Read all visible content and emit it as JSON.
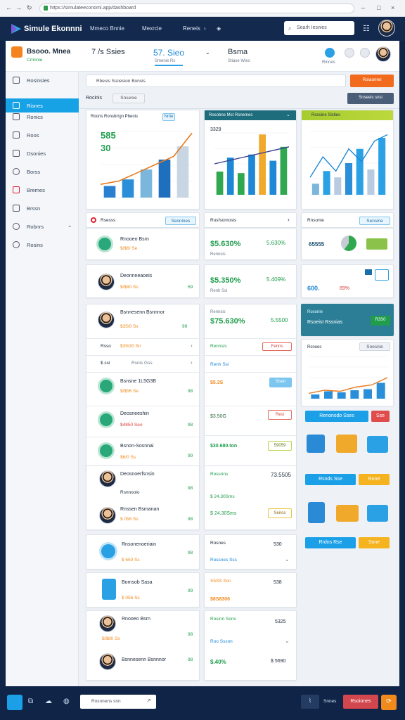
{
  "browser": {
    "url": "https://simulateeconomi.app/dashboard"
  },
  "app": {
    "brand": "Simule Ekonnni",
    "menu": [
      "Mmeco Bnnie",
      "Mexrcie",
      "Reneis"
    ],
    "search_placeholder": "Searh Iesnies"
  },
  "header": {
    "badge_title": "Bsooo. Mnea",
    "badge_sub": "Cmnnie",
    "stat1_main": "7 /s Ssies",
    "stat2_main": "57. Sieo",
    "stat2_sub": "Smenie Rs",
    "stat3_main": "Bsma",
    "stat3_sub": "Stiase Wies",
    "right_badge": "Rlnnes"
  },
  "sidebar": {
    "items": [
      {
        "label": "Rosinsies",
        "icon": "dashboard-icon"
      },
      {
        "label": "Risnes",
        "icon": "chart-icon"
      },
      {
        "label": "Ronics",
        "icon": "document-icon"
      },
      {
        "label": "Roos",
        "icon": "folder-icon"
      },
      {
        "label": "Dsonies",
        "icon": "tag-icon"
      },
      {
        "label": "Borss",
        "icon": "search-icon"
      },
      {
        "label": "Bremes",
        "icon": "mail-icon"
      },
      {
        "label": "Brssn",
        "icon": "calendar-icon"
      },
      {
        "label": "Robnrs",
        "icon": "settings-icon"
      },
      {
        "label": "Rosins",
        "icon": "help-icon"
      }
    ]
  },
  "toolbar": {
    "filter_text": "Rbesis   Ssnesion Bonsis",
    "primary_button": "Rsiaomei",
    "secondary_button": "Snseeis snsi",
    "tab_label": "Rocinis",
    "tab_pill": "Snsenie"
  },
  "charts": {
    "c1_title": "Rooris Ronsbrrgn Pbenis",
    "c1_badge": "Nnte",
    "c1_big1": "585",
    "c1_big2": "30",
    "c2_title": "Rosobne Mst Rsnemes",
    "c2_value": "3329",
    "c3_title": "Rossine Sisties"
  },
  "chart_data": [
    {
      "type": "bar",
      "title": "Rooris Ronsbrrgn Pbenis",
      "values": [
        14,
        22,
        34,
        46,
        62
      ],
      "line": [
        16,
        20,
        30,
        40,
        50,
        78
      ]
    },
    {
      "type": "bar",
      "title": "Rosobne Mst Rsnemes",
      "values": [
        30,
        48,
        28,
        52,
        78,
        44,
        62
      ],
      "line": [
        40,
        62
      ]
    },
    {
      "type": "bar",
      "title": "Rossine Sisties",
      "values": [
        14,
        30,
        22,
        40,
        58,
        32,
        72
      ],
      "line": [
        22,
        48,
        30,
        58,
        42,
        68,
        76
      ]
    },
    {
      "type": "bar",
      "title": "Rsnoes",
      "values": [
        8,
        14,
        12,
        16,
        18,
        30
      ],
      "line": [
        10,
        16,
        14,
        22,
        26,
        40
      ]
    }
  ],
  "panels": {
    "col1_head": "Rsesss",
    "col1_pill": "Sesnines",
    "col2_head": "Rosfsomosis",
    "col3_head": "Rnsonie",
    "col3_pill": "Sensine"
  },
  "people": [
    {
      "name": "Rnooeo Bsrn",
      "amount": "$/$6/ Se"
    },
    {
      "name": "Deonnneaoeis",
      "amount": "$/$80 Ss"
    },
    {
      "name": "Bsnnesenn Bsnnnor",
      "amount": "$35/0 Ss"
    }
  ],
  "col1_rows": [
    {
      "a": "Rsso",
      "b": "$39/30 Sn"
    },
    {
      "a": "$ ssi",
      "b": "Rsnis Gss"
    },
    {
      "name": "Bsnsne 1L5G3B",
      "amount": "$/$56 Se"
    },
    {
      "name": "Deosneeshin",
      "amount": "$4850 Seo"
    },
    {
      "name": "Bsnon-Sosnnai",
      "amount": "$6/0 Ss"
    },
    {
      "name": "Deosnoerfsnsin",
      "amount": "$58 Sn"
    },
    {
      "name": "Rsnnooio",
      "amount": "$00030 Ss"
    },
    {
      "name": "Rnssen Bsmanan",
      "amount": "$ 058 Ss"
    },
    {
      "name": "Rnsonenoeriain",
      "amount": "$ 650 Ss"
    },
    {
      "name": "Bomsob Sasa",
      "amount": "$ 056 Ss"
    }
  ],
  "col1_right": [
    "59",
    "99",
    "98",
    "98",
    "99",
    "98",
    "98",
    "98",
    "99",
    "98",
    "98"
  ],
  "col2_rows": [
    {
      "v": "$5.630%",
      "r": "5.630%"
    },
    {
      "v": "$5.350%",
      "r": "5.409%"
    },
    {
      "v": "$75.630%",
      "r": "5.5500"
    },
    {
      "a": "Rennsis",
      "tag": "Fenns"
    },
    {
      "a": "Renh Ssi",
      "tag": ""
    },
    {
      "v": "$5.3S",
      "tag": "Sisen"
    },
    {
      "v": "$3.50G",
      "tag": "Resi"
    },
    {
      "v": "$30.680.ton",
      "tag": "59059"
    },
    {
      "a": "Rossnns",
      "r": "73.5505"
    },
    {
      "a": "$ 24.30Sms",
      "tag": "Seiros"
    },
    {
      "a": "Rosnes",
      "r": "530"
    },
    {
      "a": "Rossnes Sss",
      "r": ""
    },
    {
      "a": "S5SS Ssn",
      "r": "538"
    },
    {
      "a": "Resssss Rs",
      "r": ""
    },
    {
      "v": "$8S8306",
      "r": ""
    },
    {
      "a": "Rosinn Sons",
      "r": "5325"
    },
    {
      "a": "Roo Sssnn",
      "r": ""
    },
    {
      "v": "$.40%",
      "r": "$ 5690"
    }
  ],
  "col3": {
    "r1": "65555",
    "r2_a": "600.",
    "r2_b": "89%",
    "teal_title": "Rosonie",
    "teal_sub": "Rsoeist Rssnias",
    "teal_btn": "R3S0",
    "chart_head": "Rsnoes",
    "chart_pill": "Snesnie",
    "btn_blue1": "Renonsdo Sses",
    "btn_red1": "Sse",
    "btn_blue2": "Rsnds Sse",
    "btn_orange2": "Rone",
    "btn_blue3": "Rrdns Rse",
    "btn_orange3": "Sone"
  },
  "bottom": {
    "search": "Rosnnens snn",
    "btn1": "Rsoiones",
    "sec_icon": "Snnes"
  }
}
